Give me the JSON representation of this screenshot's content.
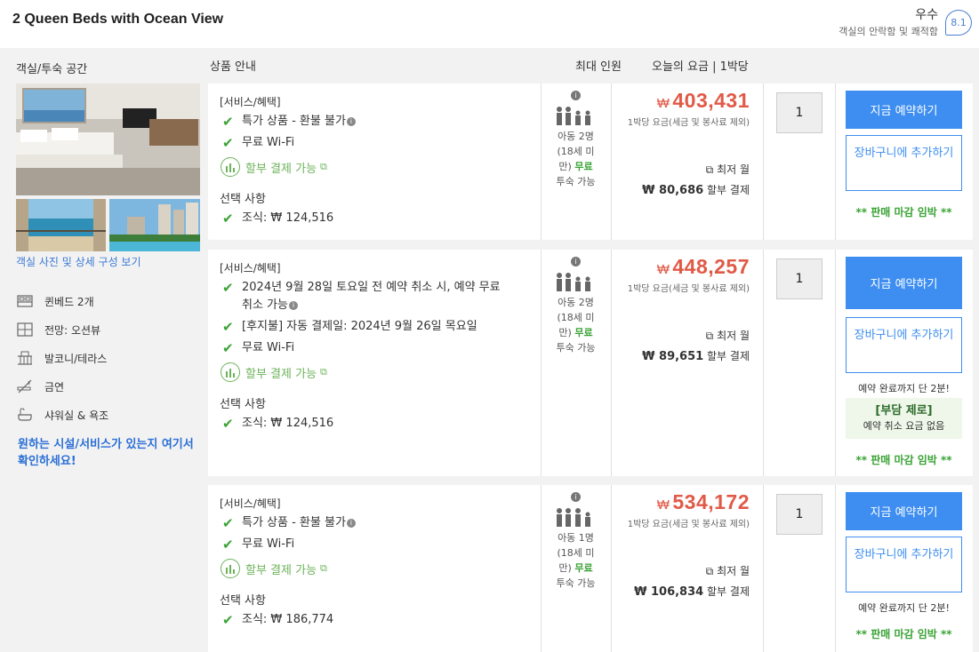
{
  "header": {
    "room_title": "2 Queen Beds with Ocean View",
    "rating_word": "우수",
    "rating_sub": "객실의 안락함 및 쾌적함",
    "rating_score": "8.1"
  },
  "left": {
    "heading": "객실/투숙 공간",
    "photo_link": "객실 사진 및 상세 구성 보기",
    "amenities": [
      {
        "icon": "bed-icon",
        "label": "퀸베드 2개"
      },
      {
        "icon": "view-icon",
        "label": "전망: 오션뷰"
      },
      {
        "icon": "balcony-icon",
        "label": "발코니/테라스"
      },
      {
        "icon": "no-smoking-icon",
        "label": "금연"
      },
      {
        "icon": "shower-icon",
        "label": "샤워실 & 욕조"
      }
    ],
    "facility_link": "원하는 시설/서비스가 있는지 여기서 확인하세요!"
  },
  "columns": {
    "products": "상품 안내",
    "max_guests": "최대 인원",
    "todays_rate": "오늘의 요금 | 1박당"
  },
  "offers": [
    {
      "benefits_heading": "[서비스/혜택]",
      "benefits": [
        "특가 상품 - 환불 불가",
        "무료 Wi-Fi"
      ],
      "installment": "할부 결제 가능",
      "options_heading": "선택 사항",
      "breakfast": "조식: ₩ 124,516",
      "occupancy": [
        "아동 2명",
        "(18세 미",
        "만)",
        "무료",
        "투숙 가능"
      ],
      "price_currency": "₩",
      "price": "403,431",
      "price_note": "1박당 요금(세금 및 봉사료 제외)",
      "min_month": "최저 월",
      "monthly_amount": "₩ 80,686",
      "monthly_suffix": "할부 결제",
      "qty": "1",
      "book_label": "지금 예약하기",
      "cart_label": "장바구니에 추가하기",
      "closing": "** 판매 마감 임박 **"
    },
    {
      "benefits_heading": "[서비스/혜택]",
      "benefits": [
        "2024년 9월 28일 토요일 전 예약 취소 시, 예약 무료 취소 가능",
        "[후지불] 자동 결제일: 2024년 9월 26일 목요일",
        "무료 Wi-Fi"
      ],
      "installment": "할부 결제 가능",
      "options_heading": "선택 사항",
      "breakfast": "조식: ₩ 124,516",
      "occupancy": [
        "아동 2명",
        "(18세 미",
        "만)",
        "무료",
        "투숙 가능"
      ],
      "price_currency": "₩",
      "price": "448,257",
      "price_note": "1박당 요금(세금 및 봉사료 제외)",
      "min_month": "최저 월",
      "monthly_amount": "₩ 89,651",
      "monthly_suffix": "할부 결제",
      "qty": "1",
      "book_label": "지금 예약하기",
      "cart_label": "장바구니에 추가하기",
      "two_min": "예약 완료까지 단 2분!",
      "zero_title": "[부담 제로]",
      "zero_sub": "예약 취소 요금 없음",
      "closing": "** 판매 마감 임박 **"
    },
    {
      "benefits_heading": "[서비스/혜택]",
      "benefits": [
        "특가 상품 - 환불 불가",
        "무료 Wi-Fi"
      ],
      "installment": "할부 결제 가능",
      "options_heading": "선택 사항",
      "breakfast": "조식: ₩ 186,774",
      "occupancy": [
        "아동 1명",
        "(18세 미",
        "만)",
        "무료",
        "투숙 가능"
      ],
      "price_currency": "₩",
      "price": "534,172",
      "price_note": "1박당 요금(세금 및 봉사료 제외)",
      "min_month": "최저 월",
      "monthly_amount": "₩ 106,834",
      "monthly_suffix": "할부 결제",
      "qty": "1",
      "book_label": "지금 예약하기",
      "cart_label": "장바구니에 추가하기",
      "two_min": "예약 완료까지 단 2분!",
      "closing": "** 판매 마감 임박 **"
    }
  ],
  "colors": {
    "price": "#e05a47",
    "primary_button": "#3d8ef0",
    "green": "#3aa335",
    "link": "#3a79d6"
  }
}
